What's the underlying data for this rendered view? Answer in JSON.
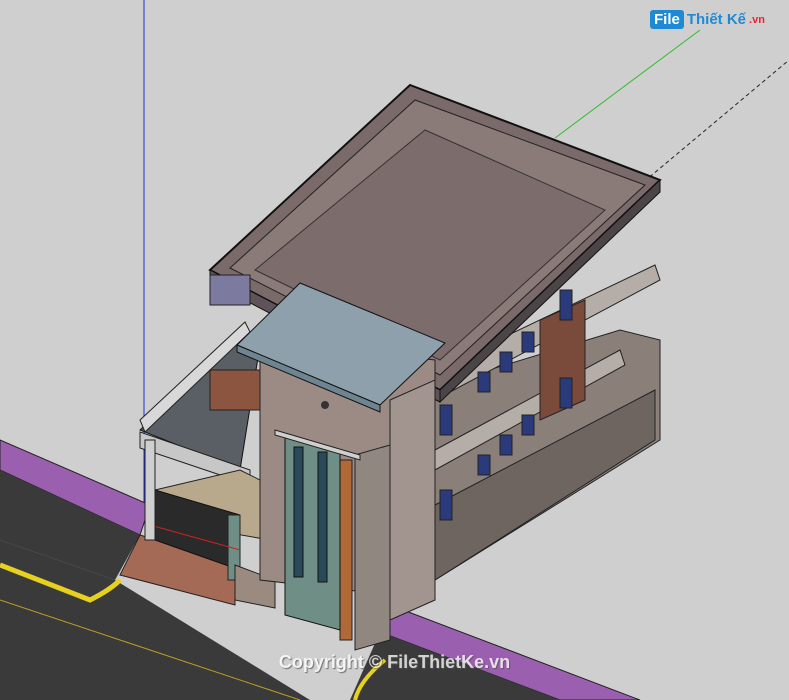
{
  "logo": {
    "part1": "File",
    "part2": "Thiết Kế",
    "part3": ".vn"
  },
  "watermark": {
    "text": "Copyright © FileThietKe.vn"
  },
  "colors": {
    "background": "#cfcfcf",
    "road": "#3a3a3a",
    "sidewalk": "#9b5fb0",
    "roof": "#7a6a6a",
    "wall": "#9c8b85",
    "accent_wall": "#7a4a3a",
    "door": "#6f8f86"
  }
}
